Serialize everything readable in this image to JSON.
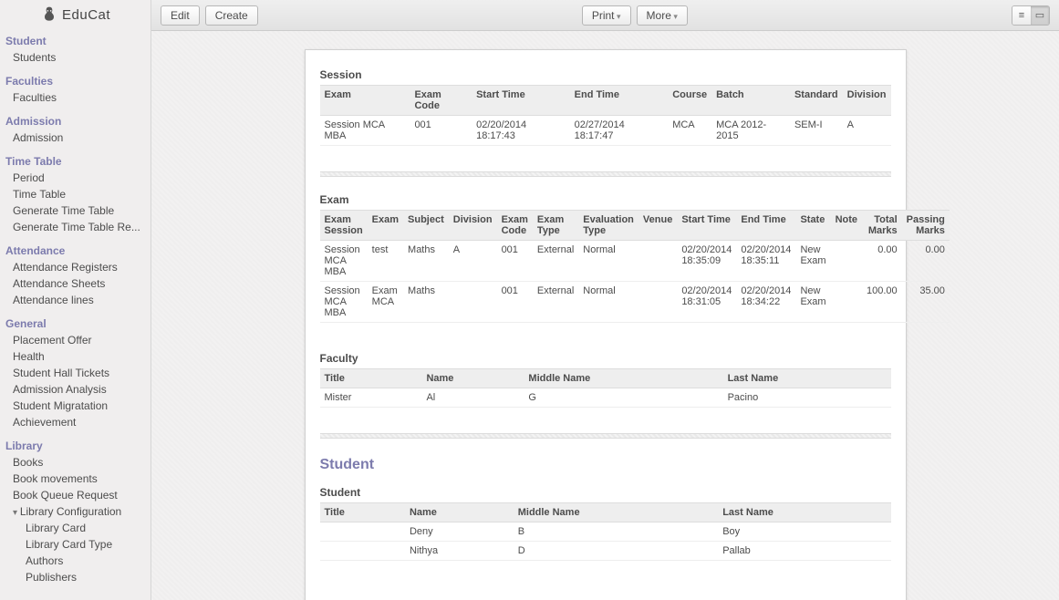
{
  "brand": "EduCat",
  "toolbar": {
    "edit": "Edit",
    "create": "Create",
    "print": "Print",
    "more": "More"
  },
  "sidebar": [
    {
      "head": "Student",
      "items": [
        "Students"
      ]
    },
    {
      "head": "Faculties",
      "items": [
        "Faculties"
      ]
    },
    {
      "head": "Admission",
      "items": [
        "Admission"
      ]
    },
    {
      "head": "Time Table",
      "items": [
        "Period",
        "Time Table",
        "Generate Time Table",
        "Generate Time Table Re..."
      ]
    },
    {
      "head": "Attendance",
      "items": [
        "Attendance Registers",
        "Attendance Sheets",
        "Attendance lines"
      ]
    },
    {
      "head": "General",
      "items": [
        "Placement Offer",
        "Health",
        "Student Hall Tickets",
        "Admission Analysis",
        "Student Migratation",
        "Achievement"
      ]
    },
    {
      "head": "Library",
      "items": [
        "Books",
        "Book movements",
        "Book Queue Request",
        {
          "label": "Library Configuration",
          "expanded": true
        },
        {
          "label": "Library Card",
          "indent": true
        },
        {
          "label": "Library Card Type",
          "indent": true
        },
        {
          "label": "Authors",
          "indent": true
        },
        {
          "label": "Publishers",
          "indent": true
        }
      ]
    }
  ],
  "session": {
    "title": "Session",
    "cols": [
      "Exam",
      "Exam Code",
      "Start Time",
      "End Time",
      "Course",
      "Batch",
      "Standard",
      "Division"
    ],
    "rows": [
      [
        "Session MCA MBA",
        "001",
        "02/20/2014 18:17:43",
        "02/27/2014 18:17:47",
        "MCA",
        "MCA 2012-2015",
        "SEM-I",
        "A"
      ]
    ]
  },
  "exam": {
    "title": "Exam",
    "cols": [
      "Exam Session",
      "Exam",
      "Subject",
      "Division",
      "Exam Code",
      "Exam Type",
      "Evaluation Type",
      "Venue",
      "Start Time",
      "End Time",
      "State",
      "Note",
      "Total Marks",
      "Passing Marks"
    ],
    "rows": [
      [
        "Session MCA MBA",
        "test",
        "Maths",
        "A",
        "001",
        "External",
        "Normal",
        "",
        "02/20/2014 18:35:09",
        "02/20/2014 18:35:11",
        "New Exam",
        "",
        "0.00",
        "0.00"
      ],
      [
        "Session MCA MBA",
        "Exam MCA",
        "Maths",
        "",
        "001",
        "External",
        "Normal",
        "",
        "02/20/2014 18:31:05",
        "02/20/2014 18:34:22",
        "New Exam",
        "",
        "100.00",
        "35.00"
      ]
    ]
  },
  "faculty": {
    "title": "Faculty",
    "cols": [
      "Title",
      "Name",
      "Middle Name",
      "Last Name"
    ],
    "rows": [
      [
        "Mister",
        "Al",
        "G",
        "Pacino"
      ]
    ]
  },
  "student_head": "Student",
  "student": {
    "title": "Student",
    "cols": [
      "Title",
      "Name",
      "Middle Name",
      "Last Name"
    ],
    "rows": [
      [
        "",
        "Deny",
        "B",
        "Boy"
      ],
      [
        "",
        "Nithya",
        "D",
        "Pallab"
      ]
    ]
  }
}
